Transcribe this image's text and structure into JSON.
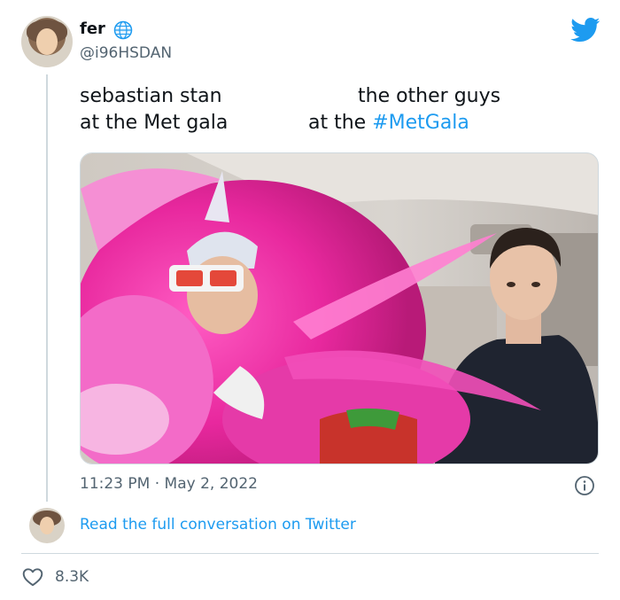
{
  "user": {
    "display_name": "fer",
    "handle": "@i96HSDAN"
  },
  "tweet": {
    "left_line1": "sebastian stan",
    "left_line2": "at the Met gala",
    "right_line1": "the other guys",
    "right_line2_prefix": "at the ",
    "right_line2_hashtag": "#MetGala",
    "timestamp": "11:23 PM · May 2, 2022",
    "media_alt": "Pink feather costume in car next to a man"
  },
  "footer": {
    "read_more": "Read the full conversation on Twitter",
    "like_count": "8.3K"
  },
  "colors": {
    "accent": "#1d9bf0",
    "secondary_text": "#536471",
    "border": "#cfd9de"
  },
  "icons": {
    "brand": "twitter-bird-icon",
    "badge": "globe-icon",
    "info": "info-icon",
    "like": "heart-icon"
  }
}
